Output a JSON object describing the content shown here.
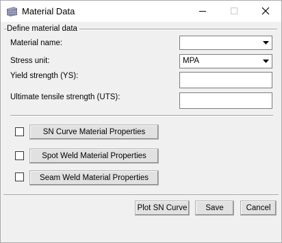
{
  "window": {
    "title": "Material Data",
    "minimize_label": "minimize",
    "maximize_label": "maximize",
    "close_label": "close"
  },
  "group": {
    "title": "Define material data"
  },
  "fields": {
    "material_name_label": "Material name:",
    "material_name_value": "",
    "stress_unit_label": "Stress unit:",
    "stress_unit_value": "MPA",
    "yield_label": "Yield strength (YS):",
    "yield_value": "",
    "uts_label": "Ultimate tensile strength (UTS):",
    "uts_value": ""
  },
  "options": [
    {
      "label": "SN Curve Material Properties",
      "checked": false
    },
    {
      "label": "Spot Weld Material Properties",
      "checked": false
    },
    {
      "label": "Seam Weld Material Properties",
      "checked": false
    }
  ],
  "footer": {
    "plot_label": "Plot SN Curve",
    "save_label": "Save",
    "cancel_label": "Cancel"
  },
  "colors": {
    "window_bg": "#f0f0f0",
    "titlebar_bg": "#ffffff",
    "button_bg": "#e1e1e1"
  },
  "icons": {
    "app": "material-data-app-icon",
    "dropdown": "chevron-down-icon"
  }
}
